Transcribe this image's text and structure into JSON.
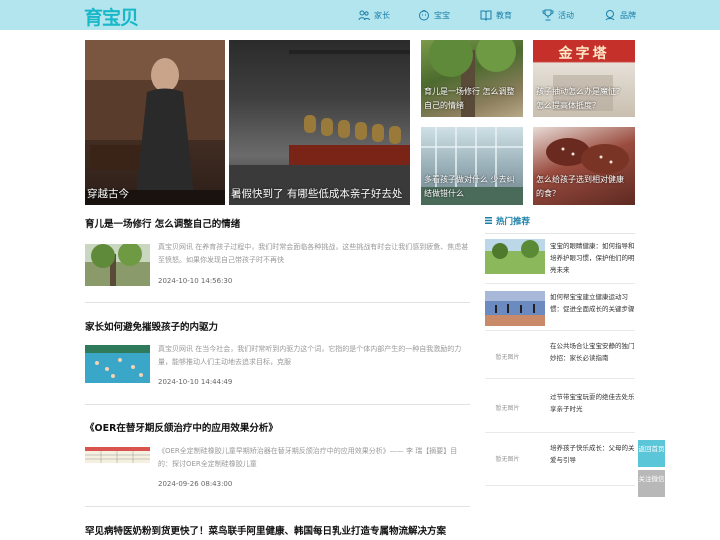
{
  "header": {
    "logo": "育宝贝",
    "nav": [
      {
        "label": "家长",
        "icon": "parent-icon"
      },
      {
        "label": "宝宝",
        "icon": "baby-icon"
      },
      {
        "label": "教育",
        "icon": "book-icon"
      },
      {
        "label": "活动",
        "icon": "trophy-icon"
      },
      {
        "label": "品牌",
        "icon": "brand-icon"
      }
    ]
  },
  "banner": {
    "tiles": [
      {
        "caption": "穿越古今"
      },
      {
        "caption": "暑假快到了 有哪些低成本亲子好去处"
      },
      {
        "caption": "育儿是一场修行 怎么调整自己的情绪"
      },
      {
        "caption": "孩子抽动怎么办是魔怔？怎么提高体抵度？",
        "sign_text": "金字塔"
      },
      {
        "caption": "多看孩子做对什么 少去纠结做错什么"
      },
      {
        "caption": "怎么给孩子选到相对健康的食？"
      }
    ]
  },
  "articles": [
    {
      "title": "育儿是一场修行 怎么调整自己的情绪",
      "excerpt": "真宝贝网讯 在养育孩子过程中，我们时常会面临各种挑战，这些挑战有时会让我们感到疲惫、焦虑甚至愤怒。如果你发现自己带孩子时不再快",
      "date": "2024-10-10 14:56:30"
    },
    {
      "title": "家长如何避免摧毁孩子的内驱力",
      "excerpt": "真宝贝网讯 在当今社会，我们时常听到内驱力这个词，它指的是个体内部产生的一种自我激励的力量，能够推动人们主动地去追求目标，克服",
      "date": "2024-10-10 14:44:49"
    },
    {
      "title": "《OER在替牙期反颌治疗中的应用效果分析》",
      "excerpt": "《OER全定制硅橡胶儿童早期矫治器在替牙期反颌治疗中的应用效果分析》—— 李 瑞【摘要】目的：探讨OER全定制硅橡胶儿童",
      "date": "2024-09-26 08:43:00"
    },
    {
      "title": "罕见病特医奶粉到货更快了！菜鸟联手阿里健康、韩国每日乳业打造专属物流解决方案"
    }
  ],
  "sidebar": {
    "heading": "热门推荐",
    "no_image_label": "暂无图片",
    "items": [
      {
        "title": "宝宝的眼睛健康：如何指导和培养护眼习惯，保护他们的明亮未来",
        "has_image": true
      },
      {
        "title": "如何帮宝宝建立健康运动习惯：促进全面成长的关键步骤",
        "has_image": true
      },
      {
        "title": "在公共场合让宝宝安静的独门妙招：家长必读指南",
        "has_image": false
      },
      {
        "title": "过节带宝宝玩耍的绝佳去处乐享亲子时光",
        "has_image": false
      },
      {
        "title": "培养孩子快乐成长：父母的关爱与引导",
        "has_image": false
      }
    ]
  },
  "float": {
    "home": "返回首页",
    "follow": "关注微信"
  },
  "colors": {
    "header_bg": "#b3e5ef",
    "accent": "#1a7fa8",
    "logo": "#19b8c8"
  }
}
